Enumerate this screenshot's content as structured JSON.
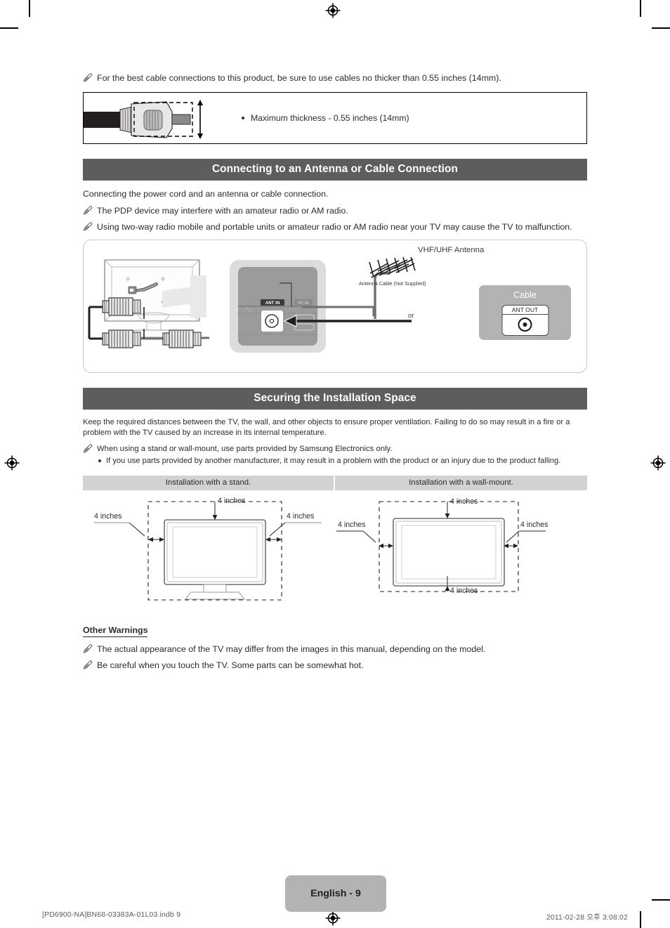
{
  "document": {
    "page_label": "English - 9",
    "footer_left": "[PD6900-NA]BN68-03383A-01L03.indb   9",
    "footer_right": "2011-02-28   오후 3:08:02"
  },
  "cable_note": {
    "note": "For the best cable connections to this product, be sure to use cables no thicker than 0.55 inches (14mm).",
    "bullet": "Maximum thickness - 0.55 inches (14mm)"
  },
  "antenna_section": {
    "title": "Connecting to an Antenna or Cable Connection",
    "intro": "Connecting the power cord and an antenna or cable connection.",
    "notes": [
      "The PDP device may interfere with an amateur radio or AM radio.",
      "Using two-way radio mobile and portable units or amateur radio or AM radio near your TV may cause the TV to malfunction."
    ],
    "diagram": {
      "antenna_label": "VHF/UHF Antenna",
      "cable_label": "Antenna Cable (Not Supplied)",
      "or_label": "or",
      "cable_box_title": "Cable",
      "ant_out_label": "ANT OUT",
      "tv_port_ant": "ANT IN",
      "tv_port_pc": "PC IN"
    }
  },
  "install_section": {
    "title": "Securing the Installation Space",
    "body": "Keep the required distances between the TV, the wall, and other objects to ensure proper ventilation. Failing to do so may result in a fire or a problem with the TV caused by an increase in its internal temperature.",
    "note": "When using a stand or wall-mount, use parts provided by Samsung Electronics only.",
    "sub_bullet": "If you use parts provided by another manufacturer, it may result in a problem with the product or an injury due to the product falling.",
    "table_headers": [
      "Installation with a stand.",
      "Installation with a wall-mount."
    ],
    "stand_dims": {
      "top": "4 inches",
      "left": "4 inches",
      "right": "4 inches"
    },
    "wall_dims": {
      "top": "4 inches",
      "left": "4 inches",
      "right": "4 inches",
      "bottom": "4 inches"
    }
  },
  "other_warnings": {
    "title": "Other Warnings",
    "notes": [
      "The actual appearance of the TV may differ from the images in this manual, depending on the model.",
      "Be careful when you touch the TV. Some parts can be somewhat hot."
    ]
  },
  "colors": {
    "section_bar": "#5e5c5c",
    "table_header": "#d2d2d2",
    "page_tag": "#b3b3b3",
    "cable_box": "#b3b3b3"
  }
}
